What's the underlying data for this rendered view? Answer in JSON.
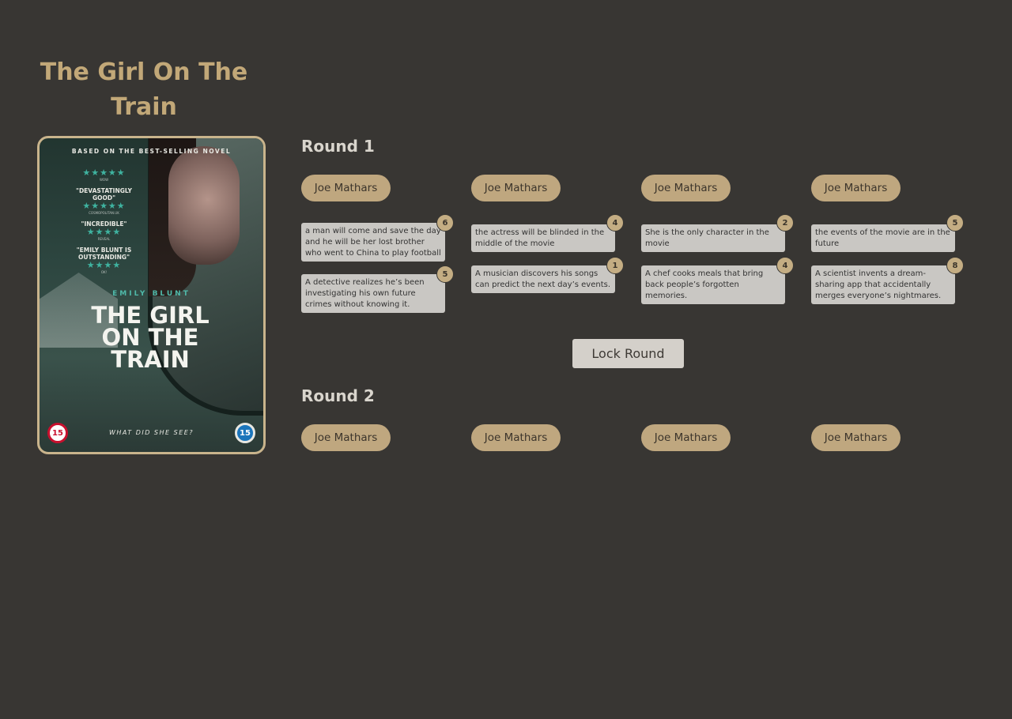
{
  "movie": {
    "title": "The Girl On The Train",
    "poster": {
      "tagline_top": "BASED ON THE BEST-SELLING NOVEL",
      "reviews": [
        {
          "stars": "★★★★★",
          "quote": "",
          "source": "WOW"
        },
        {
          "stars": "★★★★★",
          "quote": "\"DEVASTATINGLY GOOD\"",
          "source": "COSMOPOLITAN.UK"
        },
        {
          "stars": "★★★★",
          "quote": "\"INCREDIBLE\"",
          "source": "REVEAL"
        },
        {
          "stars": "★★★★",
          "quote": "\"EMILY BLUNT IS OUTSTANDING\"",
          "source": "OK!"
        }
      ],
      "actor": "EMILY BLUNT",
      "big_title": "THE GIRL ON THE TRAIN",
      "tagline_bottom": "WHAT DID SHE SEE?",
      "rating_left": "15",
      "rating_right": "15"
    }
  },
  "rounds": [
    {
      "label": "Round 1",
      "players": [
        {
          "name": "Joe Mathars",
          "guesses": [
            {
              "text": "a man will come and save the day and he will be her lost brother who went to China to play football",
              "score": "6"
            },
            {
              "text": "A detective realizes he’s been investigating his own future crimes without knowing it.",
              "score": "5"
            }
          ]
        },
        {
          "name": "Joe Mathars",
          "guesses": [
            {
              "text": "the actress will be blinded in the middle of the movie",
              "score": "4"
            },
            {
              "text": "A musician discovers his songs can predict the next day’s events.",
              "score": "1"
            }
          ]
        },
        {
          "name": "Joe Mathars",
          "guesses": [
            {
              "text": "She is the only character in the movie",
              "score": "2"
            },
            {
              "text": "A chef cooks meals that bring back people’s forgotten memories.",
              "score": "4"
            }
          ]
        },
        {
          "name": "Joe Mathars",
          "guesses": [
            {
              "text": "the events of the movie are in the future",
              "score": "5"
            },
            {
              "text": "A scientist invents a dream-sharing app that accidentally merges everyone’s nightmares.",
              "score": "8"
            }
          ]
        }
      ],
      "lock_label": "Lock Round"
    },
    {
      "label": "Round 2",
      "players": [
        {
          "name": "Joe Mathars"
        },
        {
          "name": "Joe Mathars"
        },
        {
          "name": "Joe Mathars"
        },
        {
          "name": "Joe Mathars"
        }
      ]
    }
  ]
}
